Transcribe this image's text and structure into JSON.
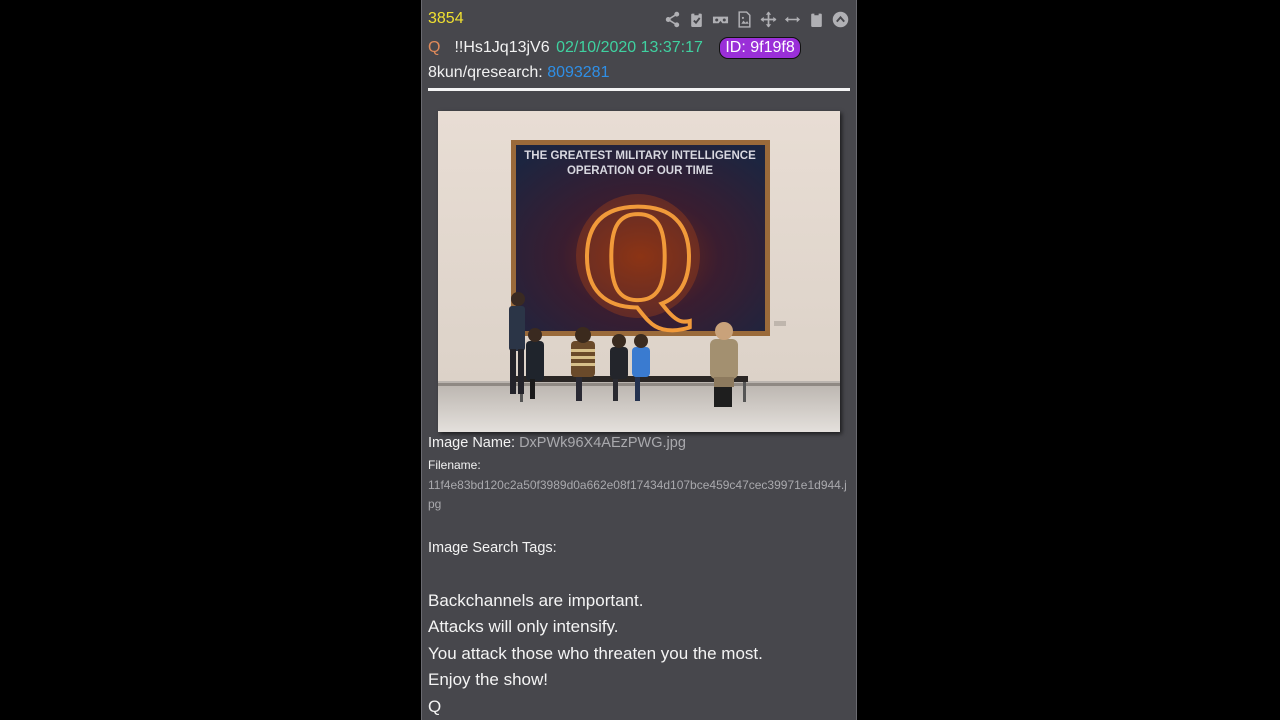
{
  "post": {
    "number": "3854",
    "author": "Q",
    "tripcode": "!!Hs1Jq13jV6",
    "datetime": "02/10/2020 13:37:17",
    "id_label": "ID: 9f19f8",
    "board": "8kun/qresearch:",
    "thread_link": "8093281"
  },
  "toolbar": {
    "icons": [
      "share-icon",
      "clipboard-check-icon",
      "vr-glasses-icon",
      "image-file-icon",
      "move-icon",
      "resize-horizontal-icon",
      "clipboard-icon",
      "scroll-up-icon"
    ]
  },
  "image": {
    "painting_text_line1": "THE GREATEST MILITARY INTELLIGENCE",
    "painting_text_line2": "OPERATION OF OUR TIME",
    "painting_letter": "Q",
    "name_label": "Image Name:",
    "name_value": "DxPWk96X4AEzPWG.jpg",
    "filename_label": "Filename:",
    "filename_value": "11f4e83bd120c2a50f3989d0a662e08f17434d107bce459c47cec39971e1d944.jpg",
    "search_tags_label": "Image Search Tags:"
  },
  "message": {
    "line1": "Backchannels are important.",
    "line2": "Attacks will only intensify.",
    "line3": "You attack those who threaten you the most.",
    "line4": "Enjoy the show!",
    "signature": "Q"
  },
  "colors": {
    "background": "#000000",
    "panel": "#47474c",
    "post_number": "#f0e030",
    "date": "#3fd1a0",
    "link": "#2f8fe6",
    "id_badge": "#9a2fd8"
  }
}
